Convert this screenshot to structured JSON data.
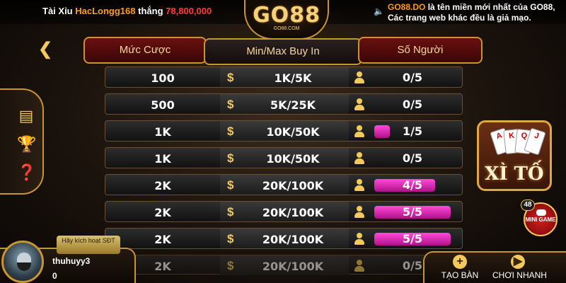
{
  "ticker": {
    "game": "Tài Xỉu",
    "user": "HacLongg168",
    "verb": "thắng",
    "amount": "78,800,000",
    "notice_domain": "GO88.DO",
    "notice_text": "là tên miền mới nhất của GO88, Các trang web khác đều là giả mạo."
  },
  "logo": {
    "main": "GO88",
    "sub": "GO88.COM"
  },
  "headers": {
    "bet": "Mức Cược",
    "buyin": "Min/Max Buy In",
    "players": "Số Người"
  },
  "rows": [
    {
      "bet": "100",
      "buyin": "1K/5K",
      "players": "0/5",
      "fill": 0
    },
    {
      "bet": "500",
      "buyin": "5K/25K",
      "players": "0/5",
      "fill": 0
    },
    {
      "bet": "1K",
      "buyin": "10K/50K",
      "players": "1/5",
      "fill": 0.2
    },
    {
      "bet": "1K",
      "buyin": "10K/50K",
      "players": "0/5",
      "fill": 0
    },
    {
      "bet": "2K",
      "buyin": "20K/100K",
      "players": "4/5",
      "fill": 0.8
    },
    {
      "bet": "2K",
      "buyin": "20K/100K",
      "players": "5/5",
      "fill": 1
    },
    {
      "bet": "2K",
      "buyin": "20K/100K",
      "players": "5/5",
      "fill": 1
    },
    {
      "bet": "2K",
      "buyin": "20K/100K",
      "players": "0/5",
      "fill": 0
    }
  ],
  "gamecard": {
    "name": "XÌ TỐ"
  },
  "mini": {
    "badge": "48",
    "label": "MINI GAME"
  },
  "user": {
    "activate": "Hãy kích hoạt SĐT",
    "name": "thuhuyy3",
    "balance": "0"
  },
  "buttons": {
    "create": "TẠO BÀN",
    "quick": "CHƠI NHANH"
  },
  "icons": {
    "back": "chevron-left-icon",
    "side": [
      "document-icon",
      "trophy-icon",
      "help-icon"
    ],
    "coin": "dollar-icon",
    "person": "person-icon"
  },
  "colors": {
    "gold": "#f2c95a",
    "fill": "#e020b8",
    "header": "#6a1010"
  }
}
